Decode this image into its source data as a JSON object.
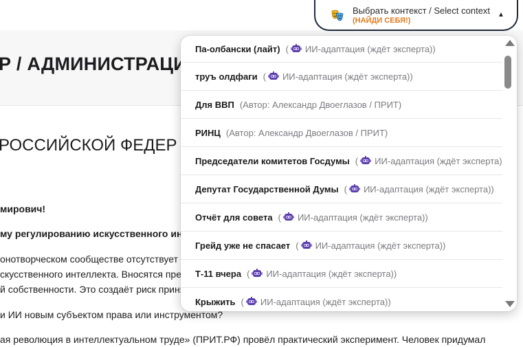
{
  "document": {
    "heading": "Р / АДМИНИСТРАЦИ",
    "subheading": "РОССИЙСКОЙ ФЕДЕР",
    "lines": [
      {
        "text": "мирович!",
        "bold": true
      },
      {
        "text": "му регулированию искусственного инт",
        "bold": true
      },
      {
        "text": "онотворческом сообществе отсутствует е",
        "bold": false
      },
      {
        "text": "скусственного интеллекта. Вносятся пред",
        "bold": false
      },
      {
        "text": "й собственности. Это создаёт риск принят",
        "bold": false
      },
      {
        "text": "и ИИ новым субъектом права или инструментом?",
        "bold": false
      },
      {
        "text": "ая революция в интеллектуальном труде» (ПРИТ.РФ) провёл практический эксперимент. Человек придумал",
        "bold": false
      }
    ]
  },
  "context_selector": {
    "title": "Выбрать контекст / Select context",
    "subtitle": "(НАЙДИ СЕБЯ!)",
    "icon": "theater-masks-icon",
    "caret": "▲",
    "accent_color": "#e07b1f",
    "border_color": "#1f2a3a"
  },
  "dropdown": {
    "items": [
      {
        "name": "Па-олбански (лайт)",
        "meta": "ИИ-адаптация (ждёт эксперта))",
        "robot": true,
        "prefix": "("
      },
      {
        "name": "труъ олдфаги",
        "meta": "ИИ-адаптация (ждёт эксперта))",
        "robot": true,
        "prefix": "("
      },
      {
        "name": "Для ВВП",
        "meta": "(Автор: Александр Двоеглазов / ПРИТ)",
        "robot": false,
        "prefix": ""
      },
      {
        "name": "РИНЦ",
        "meta": "(Автор: Александр Двоеглазов / ПРИТ)",
        "robot": false,
        "prefix": ""
      },
      {
        "name": "Председатели комитетов Госдумы",
        "meta": "ИИ-адаптация (ждёт эксперта))",
        "robot": true,
        "prefix": "("
      },
      {
        "name": "Депутат Государственной Думы",
        "meta": "ИИ-адаптация (ждёт эксперта))",
        "robot": true,
        "prefix": "("
      },
      {
        "name": "Отчёт для совета",
        "meta": "ИИ-адаптация (ждёт эксперта))",
        "robot": true,
        "prefix": "("
      },
      {
        "name": "Грейд уже не спасает",
        "meta": "ИИ-адаптация (ждёт эксперта))",
        "robot": true,
        "prefix": "("
      },
      {
        "name": "Т-11 вчера",
        "meta": "ИИ-адаптация (ждёт эксперта))",
        "robot": true,
        "prefix": "("
      },
      {
        "name": "Крыжить",
        "meta": "ИИ-адаптация (ждёт эксперта))",
        "robot": true,
        "prefix": "("
      }
    ]
  }
}
